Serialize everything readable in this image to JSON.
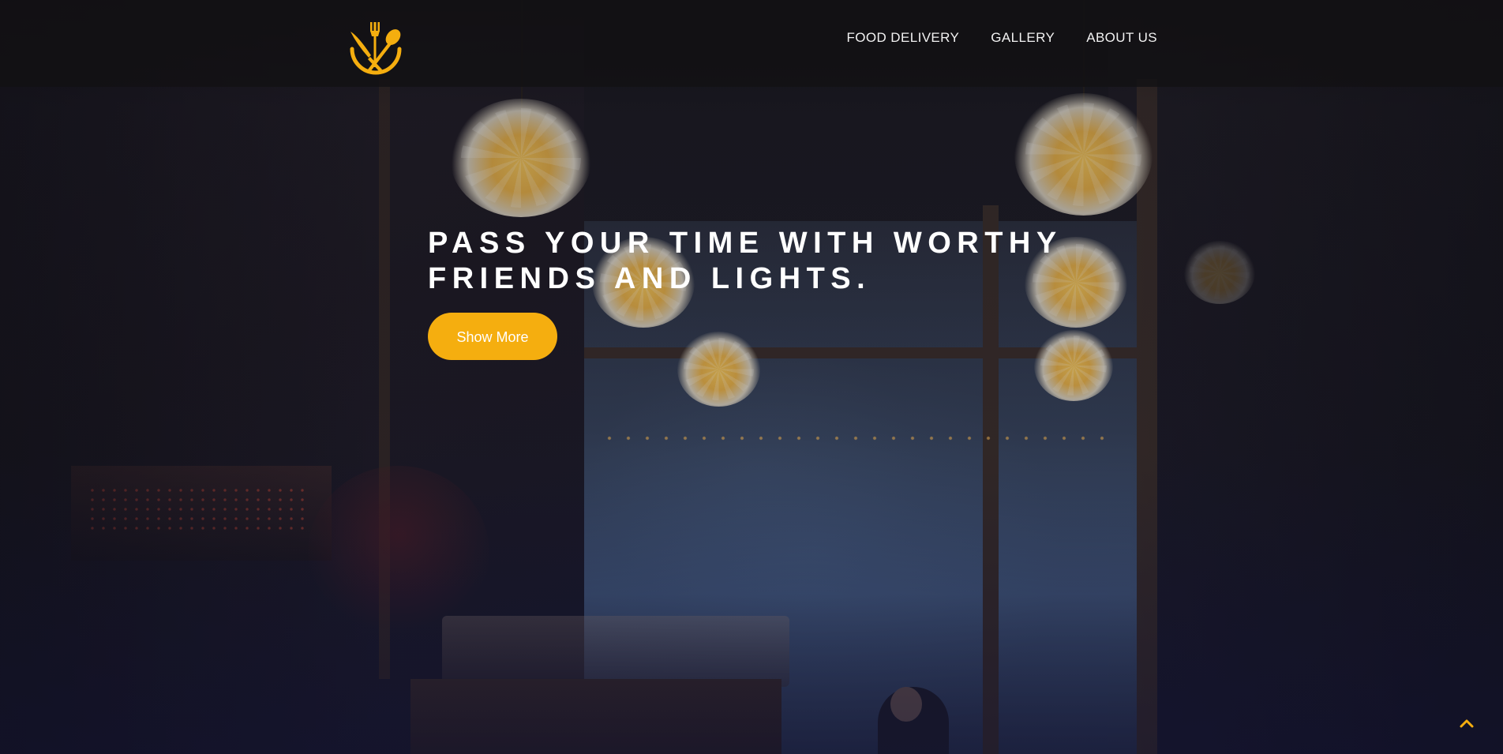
{
  "header": {
    "logo_icon": "fork-knife-spoon-icon",
    "brand_color": "#f5ae0f",
    "nav": [
      {
        "label": "FOOD DELIVERY"
      },
      {
        "label": "GALLERY"
      },
      {
        "label": "ABOUT US"
      }
    ]
  },
  "hero": {
    "title_line1": "PASS YOUR TIME WITH WORTHY",
    "title_line2": "FRIENDS AND LIGHTS.",
    "button_label": "Show More",
    "button_color": "#f5ae0f",
    "background_image": "dark restaurant interior with pendant lamps"
  },
  "scroll_top": {
    "icon": "chevron-up-icon",
    "color": "#f5ae0f"
  }
}
